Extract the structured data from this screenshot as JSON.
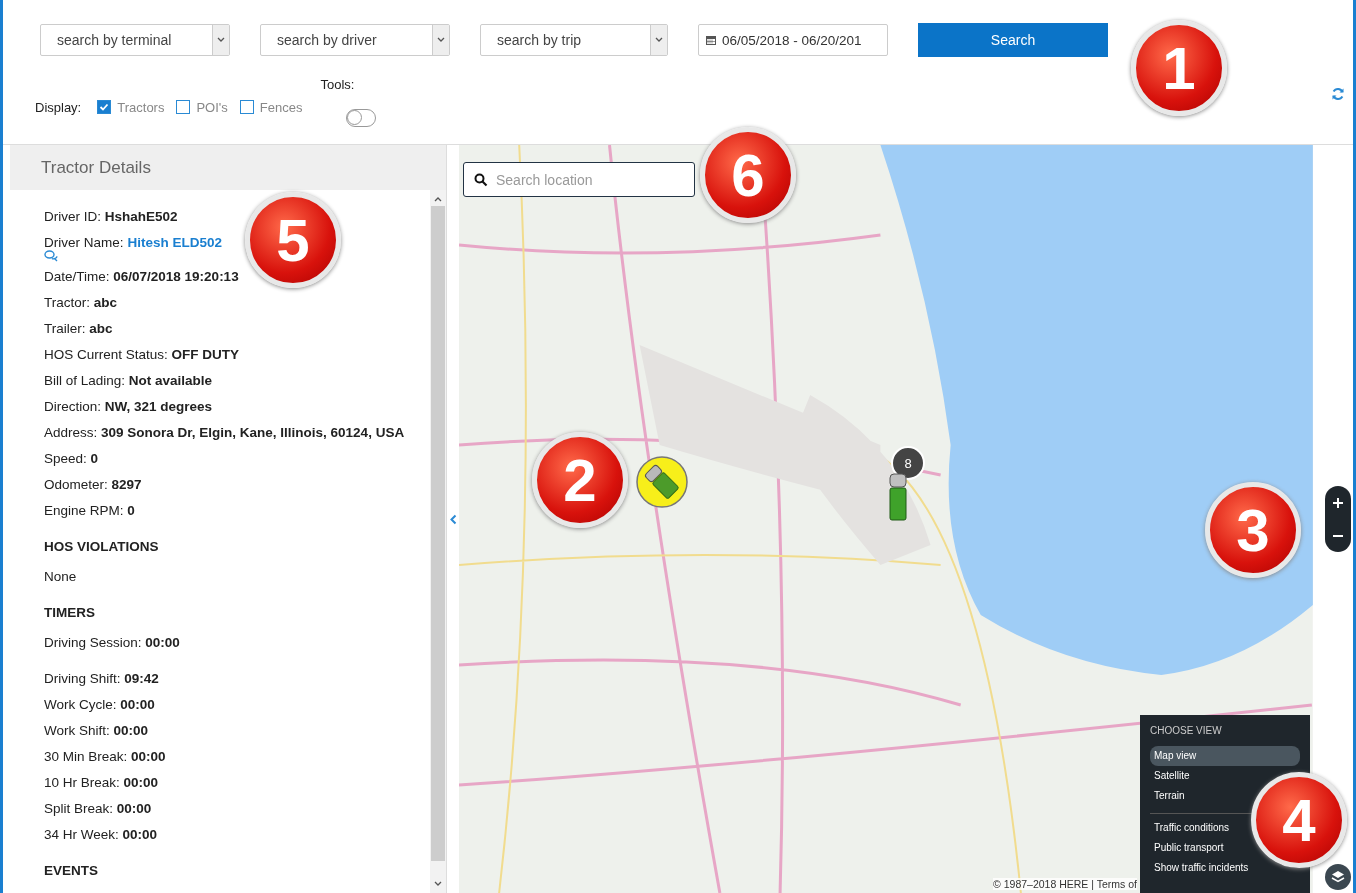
{
  "filters": {
    "selects": [
      {
        "placeholder": "search by terminal"
      },
      {
        "placeholder": "search by driver"
      },
      {
        "placeholder": "search by trip"
      }
    ],
    "date_range": "06/05/2018 - 06/20/201",
    "search_button": "Search"
  },
  "display": {
    "label": "Display:",
    "options": [
      {
        "label": "Tractors",
        "checked": true
      },
      {
        "label": "POI's",
        "checked": false
      },
      {
        "label": "Fences",
        "checked": false
      }
    ],
    "tools": {
      "label": "Tools:",
      "on": false
    }
  },
  "panel": {
    "title": "Tractor Details",
    "rows": [
      {
        "kind": "field",
        "label": "Driver ID:",
        "value": "HshahE502"
      },
      {
        "kind": "link",
        "label": "Driver Name:",
        "value": "Hitesh ELD502"
      },
      {
        "kind": "field",
        "label": "Date/Time:",
        "value": "06/07/2018 19:20:13"
      },
      {
        "kind": "field",
        "label": "Tractor:",
        "value": "abc"
      },
      {
        "kind": "field",
        "label": "Trailer:",
        "value": "abc"
      },
      {
        "kind": "field",
        "label": "HOS Current Status:",
        "value": "OFF DUTY"
      },
      {
        "kind": "field",
        "label": "Bill of Lading:",
        "value": "Not available"
      },
      {
        "kind": "field",
        "label": "Direction:",
        "value": "NW, 321 degrees"
      },
      {
        "kind": "field",
        "label": "Address:",
        "value": "309 Sonora Dr, Elgin, Kane, Illinois, 60124, USA"
      },
      {
        "kind": "field",
        "label": "Speed:",
        "value": "0"
      },
      {
        "kind": "field",
        "label": "Odometer:",
        "value": "8297"
      },
      {
        "kind": "field",
        "label": "Engine RPM:",
        "value": "0"
      },
      {
        "kind": "heading",
        "label": "HOS VIOLATIONS"
      },
      {
        "kind": "text",
        "label": "None"
      },
      {
        "kind": "heading",
        "label": "TIMERS"
      },
      {
        "kind": "field",
        "label": "Driving Session:",
        "value": "00:00"
      },
      {
        "kind": "field",
        "label": "Driving Shift:",
        "value": "09:42"
      },
      {
        "kind": "field",
        "label": "Work Cycle:",
        "value": "00:00"
      },
      {
        "kind": "field",
        "label": "Work Shift:",
        "value": "00:00"
      },
      {
        "kind": "field",
        "label": "30 Min Break:",
        "value": "00:00"
      },
      {
        "kind": "field",
        "label": "10 Hr Break:",
        "value": "00:00"
      },
      {
        "kind": "field",
        "label": "Split Break:",
        "value": "00:00"
      },
      {
        "kind": "field",
        "label": "34 Hr Week:",
        "value": "00:00"
      },
      {
        "kind": "heading",
        "label": "EVENTS"
      }
    ]
  },
  "map": {
    "search_placeholder": "Search location",
    "cluster_count": "8",
    "attribution": "© 1987–2018 HERE | Terms of",
    "view_menu": {
      "title": "CHOOSE VIEW",
      "views": [
        {
          "label": "Map view",
          "selected": true
        },
        {
          "label": "Satellite",
          "selected": false
        },
        {
          "label": "Terrain",
          "selected": false
        }
      ],
      "layers": [
        "Traffic conditions",
        "Public transport",
        "Show traffic incidents"
      ]
    }
  },
  "callouts": [
    "1",
    "2",
    "3",
    "4",
    "5",
    "6"
  ]
}
